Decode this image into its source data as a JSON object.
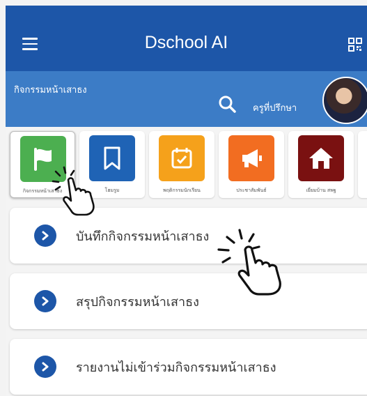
{
  "header": {
    "title": "Dschool AI",
    "menu_icon": "hamburger-menu-icon",
    "qr_icon": "qr-code-icon"
  },
  "subheader": {
    "title": "กิจกรรมหน้าเสาธง",
    "role": "ครูที่ปรึกษา",
    "search_icon": "search-icon"
  },
  "tiles": [
    {
      "label": "กิจกรรมหน้าเสาธง",
      "icon": "flag-icon",
      "color": "#4caf50"
    },
    {
      "label": "โฮมรูม",
      "icon": "bookmark-icon",
      "color": "#1f63b5"
    },
    {
      "label": "พฤติกรรมนักเรียน",
      "icon": "calendar-check-icon",
      "color": "#f5a11b"
    },
    {
      "label": "ประชาสัมพันธ์",
      "icon": "megaphone-icon",
      "color": "#f26d21"
    },
    {
      "label": "เยี่ยมบ้าน สพฐ",
      "icon": "home-icon",
      "color": "#7a1111"
    }
  ],
  "menu": [
    {
      "label": "บันทึกกิจกรรมหน้าเสาธง"
    },
    {
      "label": "สรุปกิจกรรมหน้าเสาธง"
    },
    {
      "label": "รายงานไม่เข้าร่วมกิจกรรมหน้าเสาธง"
    }
  ],
  "colors": {
    "primary": "#1d56a8",
    "secondary": "#3c7cc6"
  }
}
